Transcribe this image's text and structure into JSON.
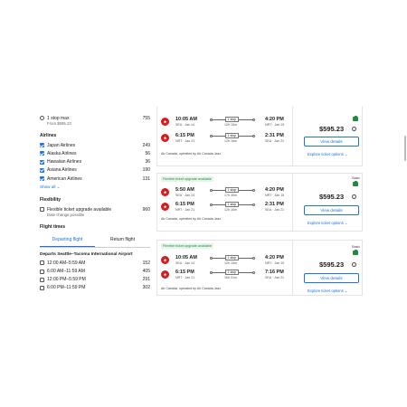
{
  "sidebar": {
    "stops": {
      "label": "1 stop max",
      "sub": "From $595.23",
      "count": "755"
    },
    "airlines_title": "Airlines",
    "airlines": [
      {
        "label": "Japan Airlines",
        "count": "249"
      },
      {
        "label": "Alaska Airlines",
        "count": "56"
      },
      {
        "label": "Hawaiian Airlines",
        "count": "36"
      },
      {
        "label": "Asiana Airlines",
        "count": "190"
      },
      {
        "label": "American Airlines",
        "count": "131"
      }
    ],
    "show_all": "Show all",
    "flex_title": "Flexibility",
    "flex": {
      "label": "Flexible ticket upgrade available",
      "sub": "Date change possible",
      "count": "960"
    },
    "times_title": "Flight times",
    "tabs": [
      "Departing flight",
      "Return flight"
    ],
    "depart_title": "Departs Seattle–Tacoma International Airport",
    "times": [
      {
        "label": "12:00 AM–5:59 AM",
        "count": "152"
      },
      {
        "label": "6:00 AM–11:59 AM",
        "count": "405"
      },
      {
        "label": "12:00 PM–5:59 PM",
        "count": "291"
      },
      {
        "label": "6:00 PM–11:59 PM",
        "count": "302"
      }
    ]
  },
  "cards": [
    {
      "upgrade": "",
      "legs": [
        {
          "dep_time": "10:05 AM",
          "dep_air": "SEA · Jan 14",
          "stop": "1 stop",
          "duration": "12h 15m",
          "arr_time": "4:20 PM",
          "arr_air": "NRT · Jan 15"
        },
        {
          "dep_time": "6:15 PM",
          "dep_air": "NRT · Jan 21",
          "stop": "1 stop",
          "duration": "12h 16m",
          "arr_time": "2:31 PM",
          "arr_air": "SEA · Jan 21"
        }
      ],
      "operator": "Air Canada, operated by Air Canada Jazz",
      "basic": "",
      "price": "$595.23",
      "view": "View details",
      "explore": "Explore ticket options"
    },
    {
      "upgrade": "Flexible ticket upgrade available",
      "legs": [
        {
          "dep_time": "5:50 AM",
          "dep_air": "SEA · Jan 14",
          "stop": "1 stop",
          "duration": "17h 30m",
          "arr_time": "4:20 PM",
          "arr_air": "NRT · Jan 15"
        },
        {
          "dep_time": "6:15 PM",
          "dep_air": "NRT · Jan 21",
          "stop": "1 stop",
          "duration": "12h 16m",
          "arr_time": "2:31 PM",
          "arr_air": "SEA · Jan 21"
        }
      ],
      "operator": "Air Canada, operated by Air Canada Jazz",
      "basic": "Basic",
      "price": "$595.23",
      "view": "View details",
      "explore": "Explore ticket options"
    },
    {
      "upgrade": "Flexible ticket upgrade available",
      "legs": [
        {
          "dep_time": "10:05 AM",
          "dep_air": "SEA · Jan 14",
          "stop": "1 stop",
          "duration": "12h 15m",
          "arr_time": "4:20 PM",
          "arr_air": "NRT · Jan 15"
        },
        {
          "dep_time": "6:15 PM",
          "dep_air": "NRT · Jan 21",
          "stop": "1 stop",
          "duration": "16h 01m",
          "arr_time": "7:16 PM",
          "arr_air": "SEA · Jan 21"
        }
      ],
      "operator": "Air Canada, operated by Air Canada Jazz",
      "basic": "Basic",
      "price": "$595.23",
      "view": "View details",
      "explore": "Explore ticket options"
    }
  ],
  "colors": {
    "accent": "#1a73e8",
    "brand": "#d71920",
    "success": "#1e8e3e"
  },
  "icons": [
    "maple-leaf-logo-icon",
    "info-icon",
    "chevron-down-icon",
    "checkmark-icon",
    "bag-icon"
  ]
}
